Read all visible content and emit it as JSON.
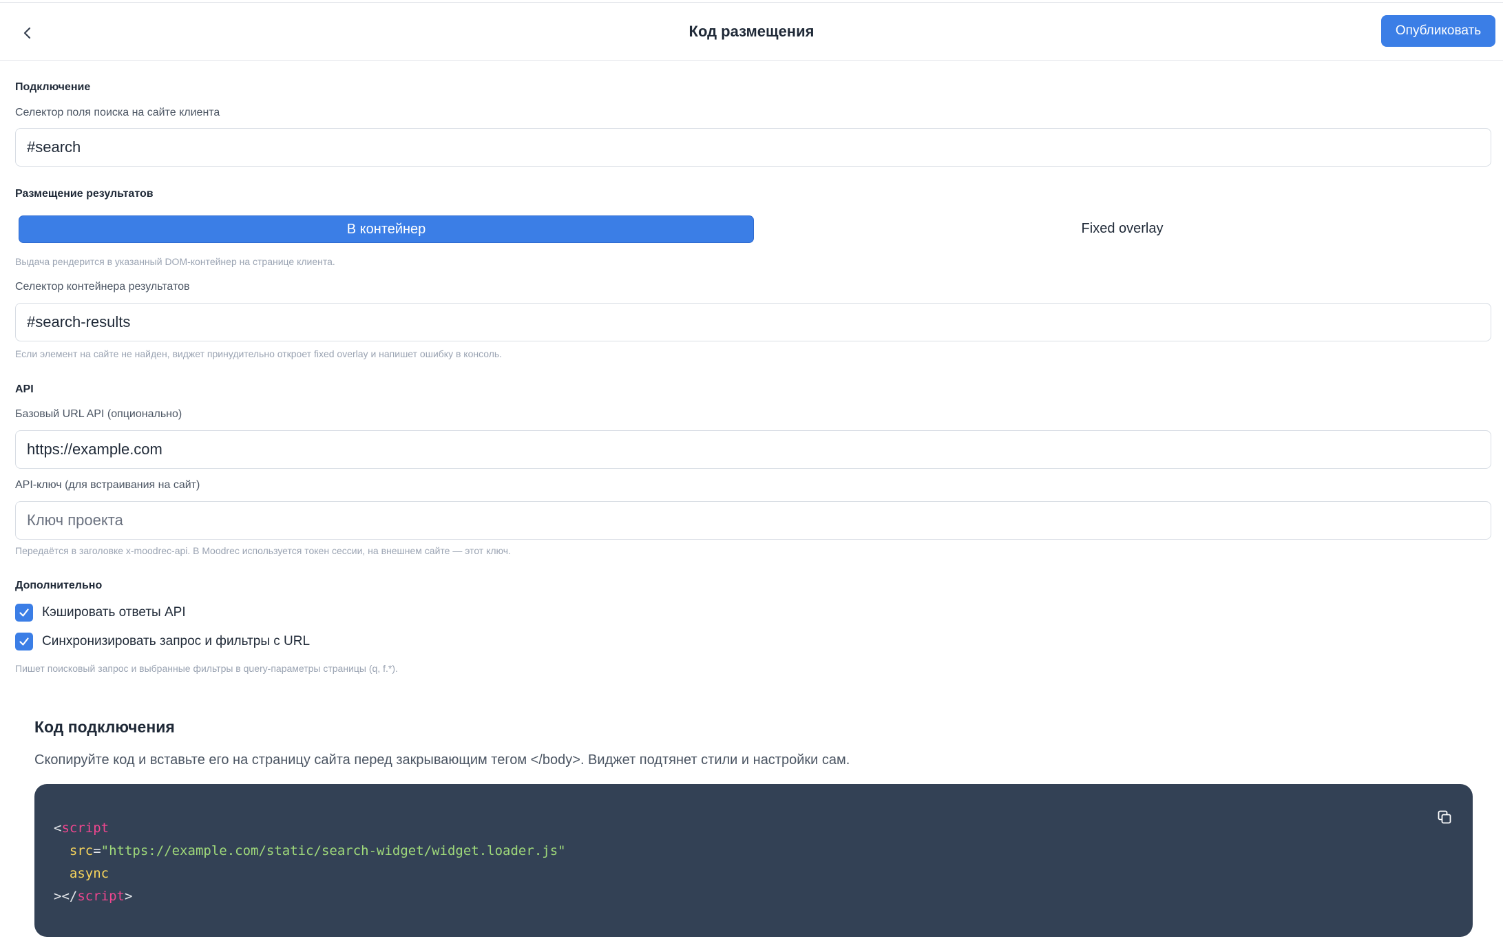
{
  "header": {
    "title": "Код размещения",
    "publish_label": "Опубликовать"
  },
  "connection": {
    "section_title": "Подключение",
    "search_selector_label": "Селектор поля поиска на сайте клиента",
    "search_selector_value": "#search"
  },
  "placement": {
    "section_title": "Размещение результатов",
    "options": [
      "В контейнер",
      "Fixed overlay"
    ],
    "selected": "В контейнер",
    "hint": "Выдача рендерится в указанный DOM-контейнер на странице клиента.",
    "container_label": "Селектор контейнера результатов",
    "container_value": "#search-results",
    "container_hint": "Если элемент на сайте не найден, виджет принудительно откроет fixed overlay и напишет ошибку в консоль."
  },
  "api": {
    "section_title": "API",
    "base_url_label": "Базовый URL API (опционально)",
    "base_url_value": "https://example.com",
    "key_label": "API-ключ (для встраивания на сайт)",
    "key_value": "",
    "key_placeholder": "Ключ проекта",
    "key_hint": "Передаётся в заголовке x-moodrec-api. В Moodrec используется токен сессии, на внешнем сайте — этот ключ."
  },
  "extra": {
    "section_title": "Дополнительно",
    "options": [
      {
        "label": "Кэшировать ответы API",
        "checked": true
      },
      {
        "label": "Синхронизировать запрос и фильтры с URL",
        "checked": true
      }
    ],
    "hint": "Пишет поисковый запрос и выбранные фильтры в query-параметры страницы (q, f.*)."
  },
  "embed_code": {
    "title": "Код подключения",
    "description": "Скопируйте код и вставьте его на страницу сайта перед закрывающим тегом </body>. Виджет подтянет стили и настройки сам.",
    "tag": "script",
    "src_attr": "src",
    "src_value": "\"https://example.com/static/search-widget/widget.loader.js\"",
    "async_attr": "async",
    "copy_icon": "copy-icon"
  },
  "colors": {
    "accent": "#3b7ee6",
    "code_bg": "#334155",
    "code_tag": "#f0468f",
    "code_attr": "#f7d45c",
    "code_string": "#9fd97a"
  }
}
